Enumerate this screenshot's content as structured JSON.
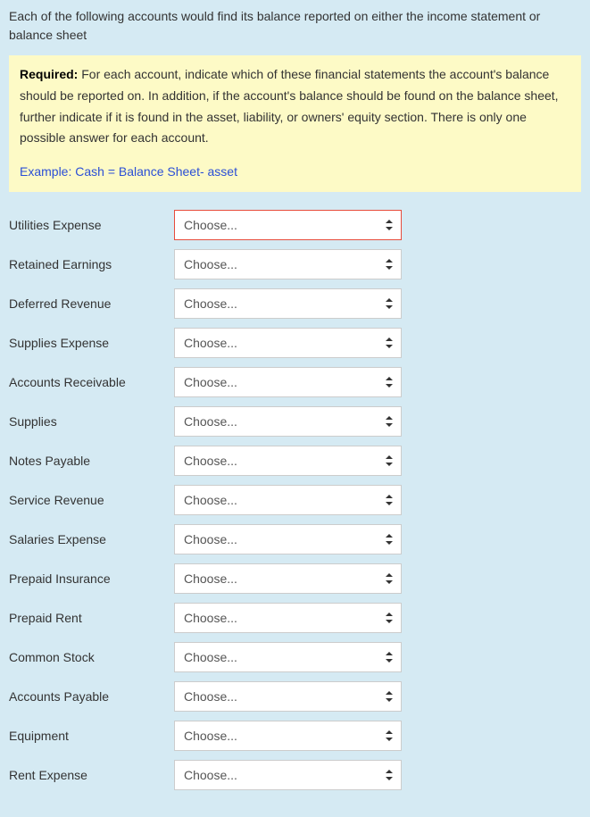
{
  "intro": "Each of the following accounts would find its balance reported on either the income statement or balance sheet",
  "requiredLabel": "Required:",
  "requiredText": " For each account, indicate which of these financial statements the account's balance should be reported on. In addition, if the account's balance should be found on the balance sheet, further indicate if it is found in the asset, liability, or owners' equity section. There is only one possible answer for each account.",
  "exampleText": "Example: Cash = Balance Sheet- asset",
  "selectPlaceholder": "Choose...",
  "accounts": [
    {
      "label": "Utilities Expense",
      "highlighted": true
    },
    {
      "label": "Retained Earnings",
      "highlighted": false
    },
    {
      "label": "Deferred Revenue",
      "highlighted": false
    },
    {
      "label": "Supplies Expense",
      "highlighted": false
    },
    {
      "label": "Accounts Receivable",
      "highlighted": false
    },
    {
      "label": "Supplies",
      "highlighted": false
    },
    {
      "label": "Notes Payable",
      "highlighted": false
    },
    {
      "label": "Service Revenue",
      "highlighted": false
    },
    {
      "label": "Salaries Expense",
      "highlighted": false
    },
    {
      "label": "Prepaid Insurance",
      "highlighted": false
    },
    {
      "label": "Prepaid Rent",
      "highlighted": false
    },
    {
      "label": "Common Stock",
      "highlighted": false
    },
    {
      "label": "Accounts Payable",
      "highlighted": false
    },
    {
      "label": "Equipment",
      "highlighted": false
    },
    {
      "label": "Rent Expense",
      "highlighted": false
    }
  ]
}
